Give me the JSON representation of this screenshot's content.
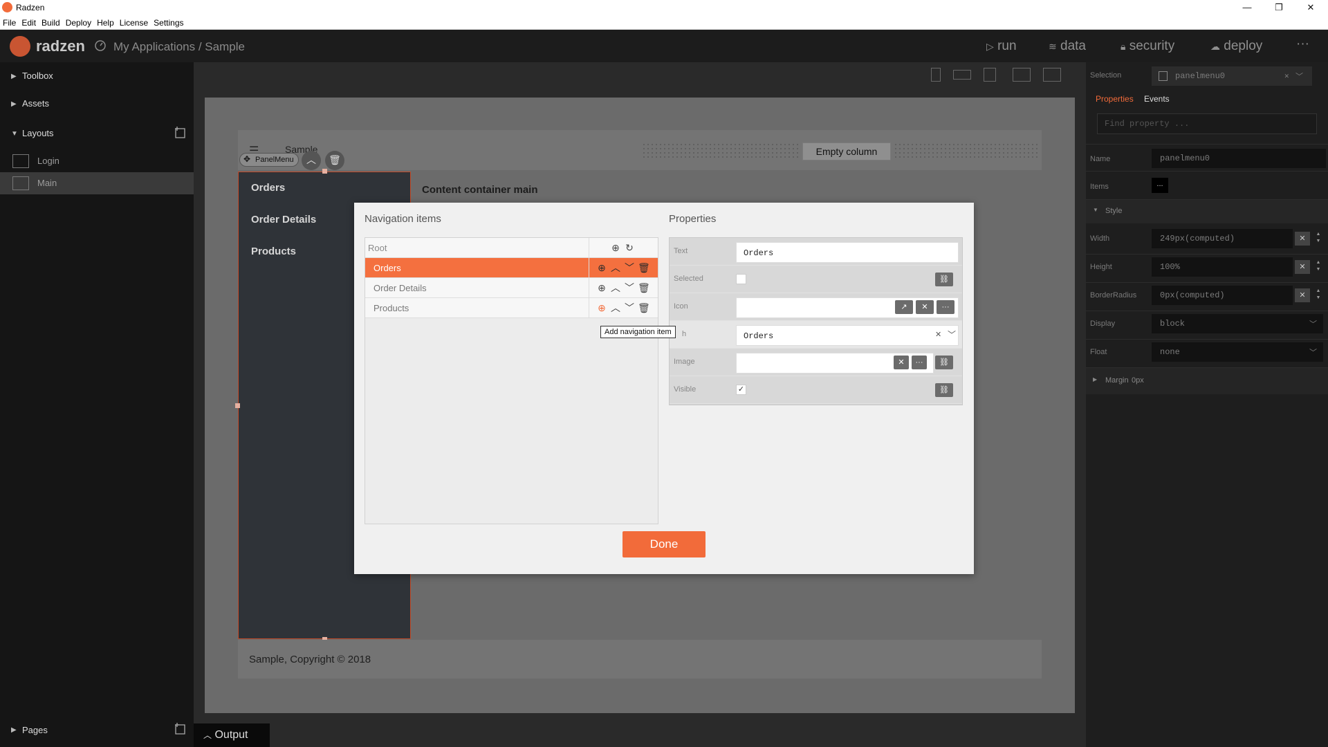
{
  "window": {
    "title": "Radzen",
    "controls": [
      "—",
      "❐",
      "✕"
    ]
  },
  "menubar": [
    "File",
    "Edit",
    "Build",
    "Deploy",
    "Help",
    "License",
    "Settings"
  ],
  "header": {
    "brand": "radzen",
    "breadcrumb": "My Applications / Sample",
    "actions": {
      "run": "run",
      "data": "data",
      "security": "security",
      "deploy": "deploy"
    },
    "more": "···"
  },
  "sidebar": {
    "toolbox": "Toolbox",
    "assets": "Assets",
    "layouts": "Layouts",
    "layout_items": [
      "Login",
      "Main"
    ],
    "pages": "Pages"
  },
  "output": {
    "label": "Output"
  },
  "canvas": {
    "app_title": "Sample",
    "panelmenu_label": "PanelMenu",
    "menu_items": [
      "Orders",
      "Order Details",
      "Products"
    ],
    "content_title": "Content container main",
    "empty_column": "Empty column",
    "footer": "Sample, Copyright © 2018"
  },
  "dialog": {
    "nav_title": "Navigation items",
    "props_title": "Properties",
    "root_label": "Root",
    "nav_items": [
      "Orders",
      "Order Details",
      "Products"
    ],
    "selected_index": 0,
    "tooltip": "Add navigation item",
    "properties": {
      "text_label": "Text",
      "text_value": "Orders",
      "selected_label": "Selected",
      "icon_label": "Icon",
      "path_label": "h",
      "path_value": "Orders",
      "image_label": "Image",
      "visible_label": "Visible",
      "visible_checked": true
    },
    "done": "Done"
  },
  "right_panel": {
    "selection_label": "Selection",
    "selection_value": "panelmenu0",
    "tabs": [
      "Properties",
      "Events"
    ],
    "find_placeholder": "Find property ...",
    "name_label": "Name",
    "name_value": "panelmenu0",
    "items_label": "Items",
    "items_value": "...",
    "style_label": "Style",
    "width_label": "Width",
    "width_value": "249px(computed)",
    "height_label": "Height",
    "height_value": "100%",
    "radius_label": "BorderRadius",
    "radius_value": "0px(computed)",
    "display_label": "Display",
    "display_value": "block",
    "float_label": "Float",
    "float_value": "none",
    "margin_label": "Margin",
    "margin_value": "0px"
  },
  "colors": {
    "accent": "#f26b3a",
    "header_bg": "#1c1c1c",
    "sidebar_bg": "#151515"
  }
}
